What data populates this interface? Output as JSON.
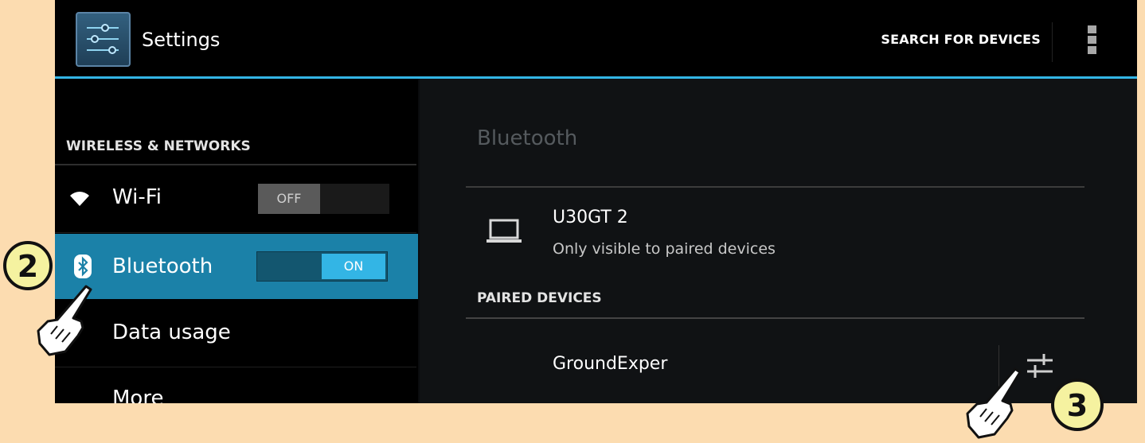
{
  "header": {
    "title": "Settings",
    "search_label": "SEARCH FOR DEVICES"
  },
  "sidebar": {
    "section_header": "WIRELESS & NETWORKS",
    "items": [
      {
        "label": "Wi-Fi",
        "toggle": "OFF",
        "icon": "wifi-icon"
      },
      {
        "label": "Bluetooth",
        "toggle": "ON",
        "icon": "bluetooth-icon",
        "selected": true
      },
      {
        "label": "Data usage",
        "icon": "none"
      },
      {
        "label": "More",
        "icon": "none"
      }
    ]
  },
  "detail": {
    "title": "Bluetooth",
    "device": {
      "name": "U30GT 2",
      "status": "Only visible to paired devices",
      "icon": "laptop-icon"
    },
    "paired_header": "PAIRED DEVICES",
    "paired_devices": [
      {
        "name": "GroundExper",
        "icon": "device-settings-icon"
      }
    ]
  },
  "callouts": {
    "step_a": "2",
    "step_b": "3"
  },
  "colors": {
    "accent": "#33b5e5",
    "selected_row": "#1b81a8",
    "page_background": "#fcdcb0",
    "badge_fill": "#f5f2a0"
  }
}
